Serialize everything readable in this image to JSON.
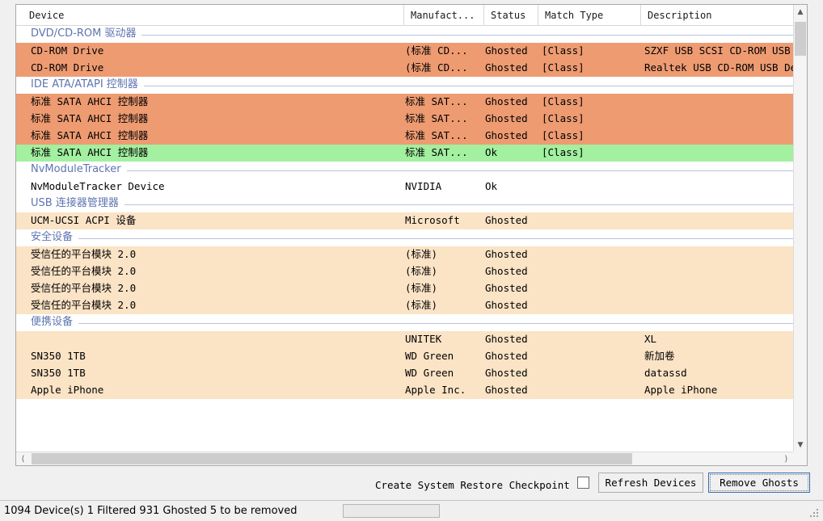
{
  "table": {
    "columns": [
      {
        "key": "device",
        "label": "Device"
      },
      {
        "key": "manufacturer",
        "label": "Manufact..."
      },
      {
        "key": "status",
        "label": "Status"
      },
      {
        "key": "match_type",
        "label": "Match Type"
      },
      {
        "key": "description",
        "label": "Description"
      }
    ],
    "groups": [
      {
        "name": "DVD/CD-ROM 驱动器",
        "rows": [
          {
            "device": "CD-ROM Drive",
            "manufacturer": "(标准 CD...",
            "status": "Ghosted",
            "match_type": "[Class]",
            "description": "SZXF USB SCSI CD-ROM USB Dev",
            "highlight": "orange"
          },
          {
            "device": "CD-ROM Drive",
            "manufacturer": "(标准 CD...",
            "status": "Ghosted",
            "match_type": "[Class]",
            "description": "Realtek USB CD-ROM USB Devic",
            "highlight": "orange"
          }
        ]
      },
      {
        "name": "IDE ATA/ATAPI 控制器",
        "rows": [
          {
            "device": "标准 SATA AHCI 控制器",
            "manufacturer": "标准 SAT...",
            "status": "Ghosted",
            "match_type": "[Class]",
            "description": "",
            "highlight": "orange"
          },
          {
            "device": "标准 SATA AHCI 控制器",
            "manufacturer": "标准 SAT...",
            "status": "Ghosted",
            "match_type": "[Class]",
            "description": "",
            "highlight": "orange"
          },
          {
            "device": "标准 SATA AHCI 控制器",
            "manufacturer": "标准 SAT...",
            "status": "Ghosted",
            "match_type": "[Class]",
            "description": "",
            "highlight": "orange"
          },
          {
            "device": "标准 SATA AHCI 控制器",
            "manufacturer": "标准 SAT...",
            "status": "Ok",
            "match_type": "[Class]",
            "description": "",
            "highlight": "green"
          }
        ]
      },
      {
        "name": "NvModuleTracker",
        "rows": [
          {
            "device": "NvModuleTracker Device",
            "manufacturer": "NVIDIA",
            "status": "Ok",
            "match_type": "",
            "description": "",
            "highlight": "plain"
          }
        ]
      },
      {
        "name": "USB 连接器管理器",
        "rows": [
          {
            "device": "UCM-UCSI ACPI 设备",
            "manufacturer": "Microsoft",
            "status": "Ghosted",
            "match_type": "",
            "description": "",
            "highlight": "peach"
          }
        ]
      },
      {
        "name": "安全设备",
        "rows": [
          {
            "device": "受信任的平台模块 2.0",
            "manufacturer": "(标准)",
            "status": "Ghosted",
            "match_type": "",
            "description": "",
            "highlight": "peach"
          },
          {
            "device": "受信任的平台模块 2.0",
            "manufacturer": "(标准)",
            "status": "Ghosted",
            "match_type": "",
            "description": "",
            "highlight": "peach"
          },
          {
            "device": "受信任的平台模块 2.0",
            "manufacturer": "(标准)",
            "status": "Ghosted",
            "match_type": "",
            "description": "",
            "highlight": "peach"
          },
          {
            "device": "受信任的平台模块 2.0",
            "manufacturer": "(标准)",
            "status": "Ghosted",
            "match_type": "",
            "description": "",
            "highlight": "peach"
          }
        ]
      },
      {
        "name": "便携设备",
        "rows": [
          {
            "device": "",
            "manufacturer": "UNITEK",
            "status": "Ghosted",
            "match_type": "",
            "description": "XL",
            "highlight": "peach"
          },
          {
            "device": "SN350 1TB",
            "manufacturer": "WD Green",
            "status": "Ghosted",
            "match_type": "",
            "description": "新加卷",
            "highlight": "peach"
          },
          {
            "device": "SN350 1TB",
            "manufacturer": "WD Green",
            "status": "Ghosted",
            "match_type": "",
            "description": "datassd",
            "highlight": "peach"
          },
          {
            "device": "Apple iPhone",
            "manufacturer": "Apple Inc.",
            "status": "Ghosted",
            "match_type": "",
            "description": "Apple iPhone",
            "highlight": "peach"
          }
        ]
      }
    ]
  },
  "scrollbars": {
    "vertical": {
      "up_icon": "chevron-up-icon",
      "down_icon": "chevron-down-icon"
    },
    "horizontal": {
      "left_icon": "chevron-left-icon",
      "right_icon": "chevron-right-icon"
    }
  },
  "controls": {
    "checkpoint_label": "Create System Restore Checkpoint",
    "checkpoint_checked": false,
    "refresh_label": "Refresh Devices",
    "remove_label": "Remove Ghosts"
  },
  "status": {
    "text": "1094 Device(s)  1 Filtered  931 Ghosted  5 to be removed",
    "device_count": 1094,
    "filtered": 1,
    "ghosted": 931,
    "to_be_removed": 5,
    "progress_percent": 0
  },
  "colors": {
    "ghost_strong": "#ee9b72",
    "ghost_light": "#fbe3c6",
    "ok_green": "#a2f0a0",
    "group_header": "#5e74b0",
    "focus_border": "#2f6fb5"
  }
}
